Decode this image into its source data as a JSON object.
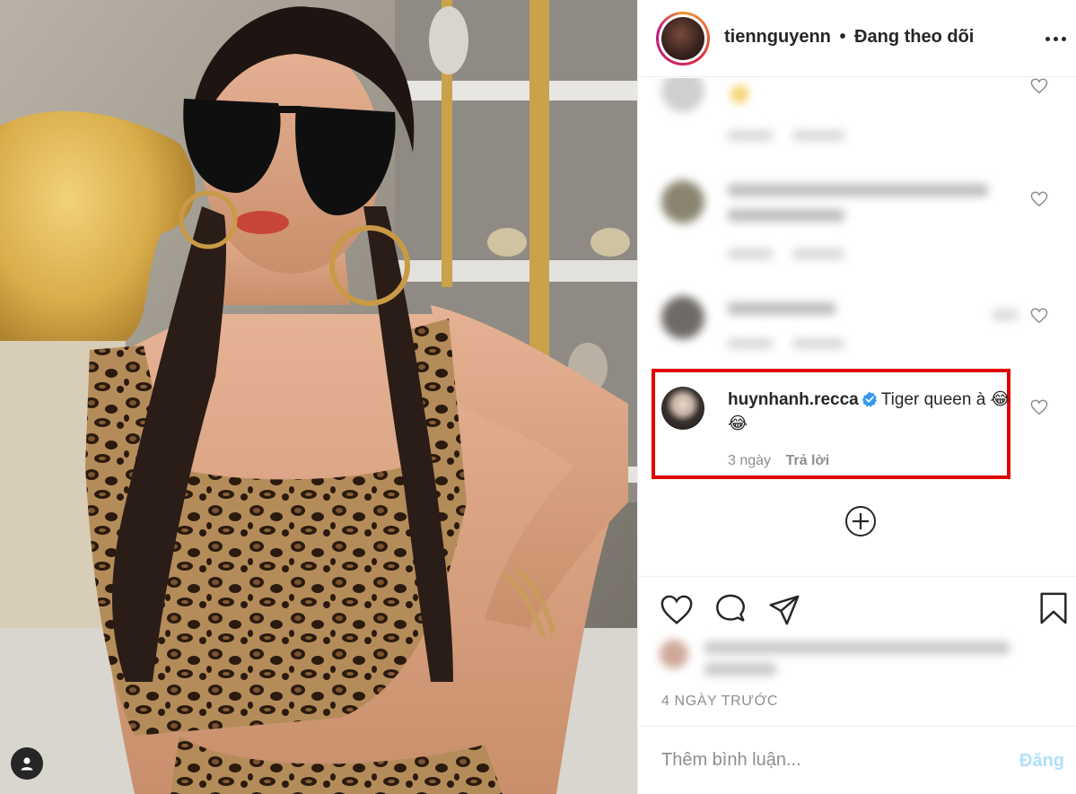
{
  "header": {
    "username": "tiennguyenn",
    "separator": "•",
    "follow_status": "Đang theo dõi"
  },
  "highlighted_comment": {
    "username": "huynhanh.recca",
    "verified": true,
    "text": "Tiger queen à 😂😂",
    "time": "3 ngày",
    "reply_label": "Trả lời"
  },
  "post": {
    "date_label": "4 NGÀY TRƯỚC"
  },
  "comment_box": {
    "placeholder": "Thêm bình luận...",
    "post_label": "Đăng"
  },
  "colors": {
    "highlight_border": "#e00000",
    "verified_badge": "#3897f0",
    "post_button_disabled": "#b2dffc",
    "secondary_text": "#8e8e8e"
  },
  "icons": [
    "more-options-icon",
    "heart-icon",
    "comment-icon",
    "share-icon",
    "bookmark-icon",
    "load-more-icon",
    "user-tag-icon",
    "verified-icon"
  ]
}
